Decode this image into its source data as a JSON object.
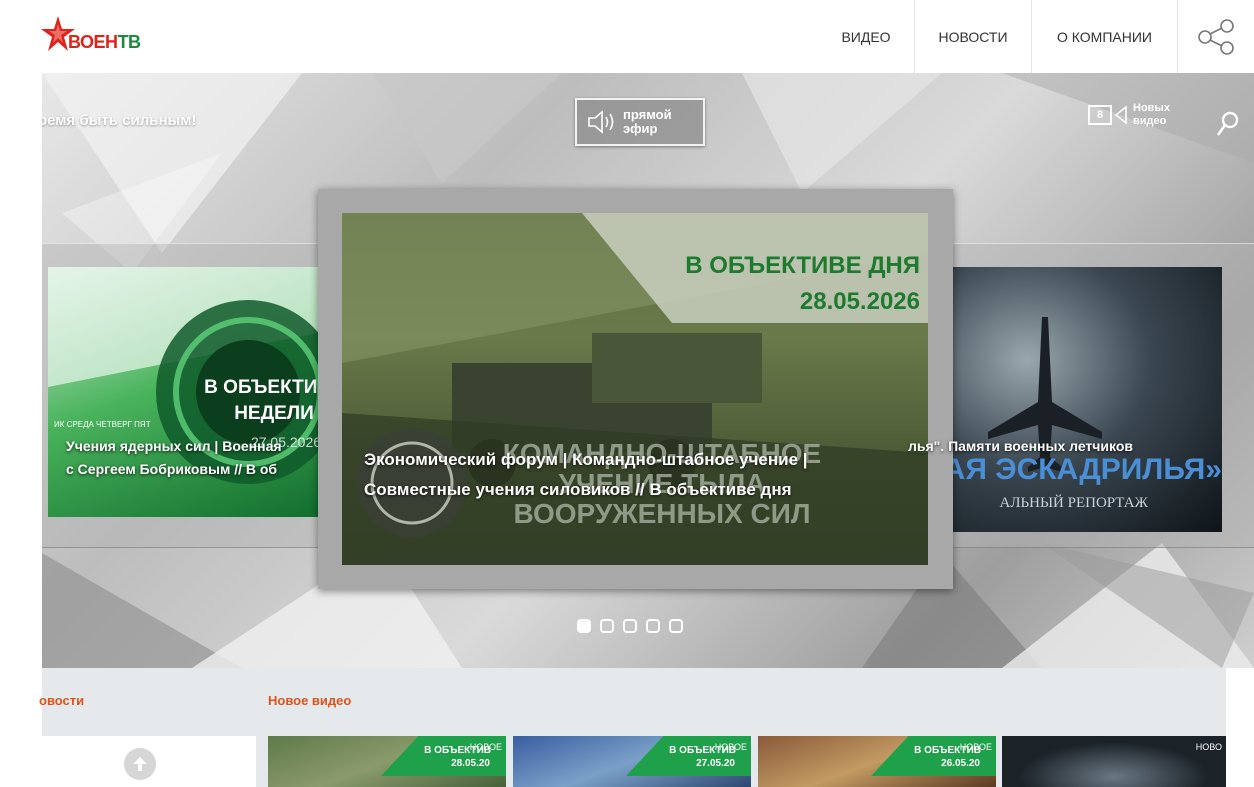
{
  "header": {
    "logo_text_a": "ВОЕН",
    "logo_text_b": "ТВ",
    "nav": [
      "ВИДЕО",
      "НОВОСТИ",
      "О КОМПАНИИ"
    ],
    "share_icon": "share-icon"
  },
  "hero": {
    "slogan": "ремя быть сильным!",
    "live": {
      "line1": "прямой",
      "line2": "эфир",
      "icon": "speaker-icon"
    },
    "new_video": {
      "count": "8",
      "line1": "Новых",
      "line2": "видео",
      "icon": "camera-icon"
    },
    "search_icon": "search-icon"
  },
  "slides": {
    "left": {
      "image_text": [
        "В ОБЪЕКТИВЕ",
        "НЕДЕЛИ",
        "ИК СРЕДА ЧЕТВЕРГ ПЯТ",
        "27.05.2026"
      ],
      "caption_line1": "Учения ядерных сил | Военная",
      "caption_line2": "с Сергеем Бобриковым // В об"
    },
    "center": {
      "image_text": [
        "В ОБЪЕКТИВЕ ДНЯ",
        "28.05.2026",
        "КОМАНДНО-ШТАБНОЕ",
        "УЧЕНИЕ ТЫЛА",
        "ВООРУЖЕННЫХ СИЛ"
      ],
      "caption_line1": "Экономический форум | Командно-штабное учение |",
      "caption_line2": "Совместные учения силовиков // В объективе дня"
    },
    "right": {
      "image_text": [
        "ТАЯ ЭСКАДРИЛЬЯ»",
        "АЛЬНЫЙ РЕПОРТАЖ"
      ],
      "caption_line1": "лья\". Памяти военных летчиков"
    },
    "dots_total": 5,
    "dots_active": 1
  },
  "lower": {
    "news_title": "овости",
    "video_title": "Новое видео",
    "up_icon": "arrow-up-icon",
    "thumbs": [
      {
        "title": "В ОБЪЕКТИВ",
        "date": "28.05.20",
        "badge": "НОВОЕ"
      },
      {
        "title": "В ОБЪЕКТИВ",
        "date": "27.05.20",
        "badge": "НОВОЕ"
      },
      {
        "title": "В ОБЪЕКТИВ",
        "date": "26.05.20",
        "badge": "НОВОЕ"
      },
      {
        "title": "",
        "date": "",
        "badge": "НОВО"
      }
    ]
  },
  "colors": {
    "brand_red": "#e0231a",
    "brand_green": "#1b8a3a",
    "section_orange": "#e0531a",
    "badge_green": "#1fa04a"
  }
}
